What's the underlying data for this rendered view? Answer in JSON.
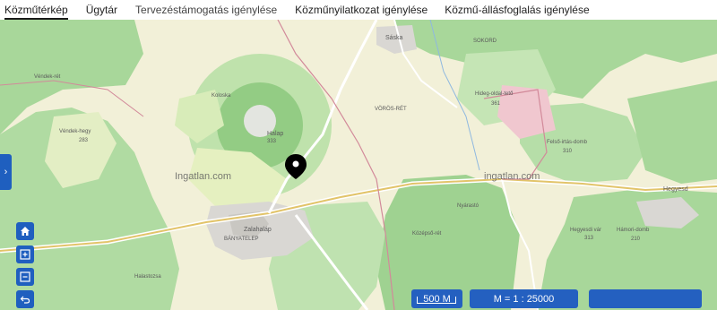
{
  "tabs": [
    {
      "label": "Közműtérkép",
      "active": true
    },
    {
      "label": "Ügytár",
      "active": false
    },
    {
      "label": "Tervezéstámogatás igénylése",
      "active": false
    },
    {
      "label": "Közműnyilatkozat igénylése",
      "active": false
    },
    {
      "label": "Közmű-állásfoglalás igénylése",
      "active": false
    }
  ],
  "map": {
    "place_labels": {
      "saska": "Sáska",
      "sokord": "SOKORD",
      "voros_ret": "VÖRÖS-RÉT",
      "hideg_oldal_tet": "Hideg-oldal-tető",
      "hideg_oldal_val": "361",
      "halap": "Halap",
      "halap_val": "333",
      "koloska": "Koloska",
      "vendek_hegy": "Véndek-hegy",
      "vendek_hegy_val": "283",
      "vendek_ret": "Véndek-rét",
      "felso_irtas_domb": "Felső-irtás-domb",
      "felso_irtas_val": "310",
      "hegyesd": "Hegyesd",
      "zalahalap": "Zalahaláp",
      "banyatelep": "BÁNYATELEP",
      "nyarasto": "Nyárastó",
      "hegyesdi_var": "Hegyesdi vár",
      "hegyesdi_val": "313",
      "hamori_domb": "Hámori-domb",
      "hamori_val": "210",
      "halas_rozsa": "Halastozsa",
      "kozepsor": "Középső-rét",
      "watermark1": "Ingatlan.com",
      "watermark2": "ingatlan.com"
    }
  },
  "controls": {
    "side_toggle_icon": "chevron-right-icon",
    "home_icon": "home-icon",
    "zoom_in_icon": "plus-square-icon",
    "zoom_out_icon": "minus-square-icon",
    "back_icon": "undo-arrow-icon"
  },
  "scale": {
    "bar_label": "500 M",
    "ratio_label": "M = 1 : 25000",
    "blank_label": ""
  }
}
